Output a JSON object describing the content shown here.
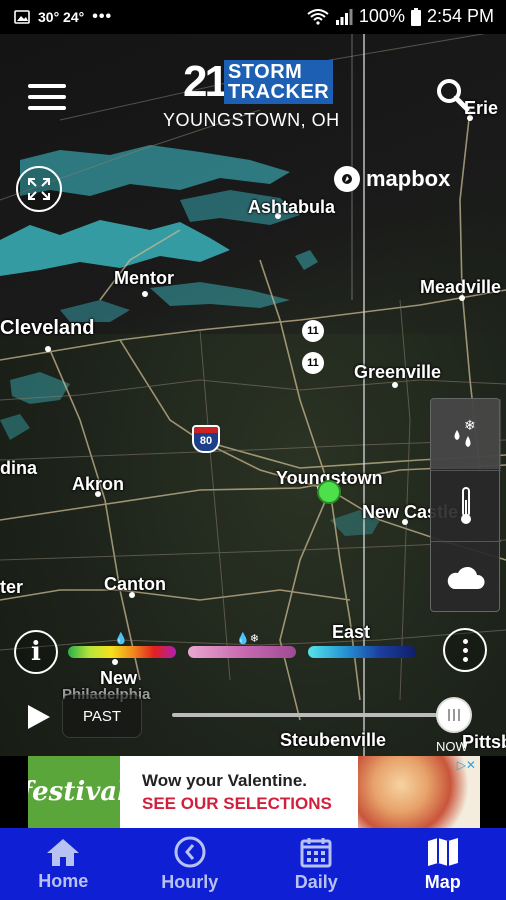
{
  "status_bar": {
    "temps": "30°  24°",
    "more": "•••",
    "battery": "100%",
    "time": "2:54 PM"
  },
  "header": {
    "logo_number": "21",
    "logo_line1": "STORM",
    "logo_line2": "TRACKER",
    "location": "YOUNGSTOWN, OH",
    "attribution": "mapbox"
  },
  "map": {
    "cities": {
      "erie": "Erie",
      "ashtabula": "Ashtabula",
      "mentor": "Mentor",
      "meadville": "Meadville",
      "cleveland": "Cleveland",
      "greenville": "Greenville",
      "dina": "dina",
      "akron": "Akron",
      "youngstown": "Youngstown",
      "new_castle": "New Castle",
      "ter": "ter",
      "canton": "Canton",
      "east": "East",
      "new": "New",
      "philadelphia": "Philadelphia",
      "steubenville": "Steubenville",
      "pittsb": "Pittsb"
    },
    "route_shields": [
      "11",
      "11"
    ],
    "interstate": "80"
  },
  "layers": [
    "precipitation-type-icon",
    "temperature-icon",
    "cloud-icon"
  ],
  "legend": {
    "rain_icon": "💧",
    "mix_icon": "💧❄",
    "info": "i"
  },
  "playback": {
    "mode_label": "PAST",
    "now_label": "NOW",
    "progress": 1.0
  },
  "ad": {
    "brand": "festival",
    "headline": "Wow your Valentine.",
    "cta": "SEE OUR SELECTIONS",
    "adchoices": "▷✕"
  },
  "bottom_nav": [
    {
      "label": "Home",
      "icon": "home-icon"
    },
    {
      "label": "Hourly",
      "icon": "clock-icon"
    },
    {
      "label": "Daily",
      "icon": "calendar-icon"
    },
    {
      "label": "Map",
      "icon": "map-icon"
    }
  ],
  "colors": {
    "nav_bg": "#0f1fd4",
    "logo_blue": "#1d5fb3",
    "location_dot": "#4ee04a"
  }
}
